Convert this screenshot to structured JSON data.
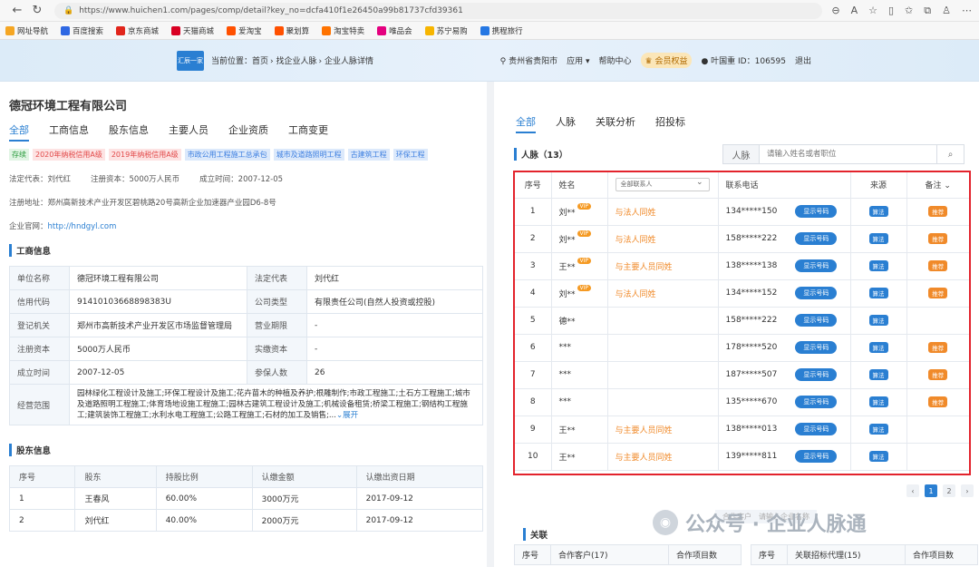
{
  "browser": {
    "url": "https://www.huichen1.com/pages/comp/detail?key_no=dcfa410f1e26450a99b81737cfd39361"
  },
  "bookmarks": [
    {
      "label": "网址导航",
      "color": "#f5a623"
    },
    {
      "label": "百度搜索",
      "color": "#2f68e3"
    },
    {
      "label": "京东商城",
      "color": "#e1251b"
    },
    {
      "label": "天猫商城",
      "color": "#d90023"
    },
    {
      "label": "爱淘宝",
      "color": "#ff5000"
    },
    {
      "label": "聚划算",
      "color": "#ff5000"
    },
    {
      "label": "淘宝特卖",
      "color": "#ff7300"
    },
    {
      "label": "唯品会",
      "color": "#e4007f"
    },
    {
      "label": "苏宁易购",
      "color": "#f7b500"
    },
    {
      "label": "携程旅行",
      "color": "#2577e3"
    }
  ],
  "header": {
    "logo": "汇辰一家",
    "breadcrumb": [
      "当前位置：首页",
      "找企业人脉",
      "企业人脉详情"
    ],
    "location": "贵州省贵阳市",
    "apps": "应用",
    "help": "帮助中心",
    "vip": "会员权益",
    "user": "叶国重 ID：106595",
    "logout": "退出"
  },
  "company": {
    "name": "德冠环境工程有限公司",
    "tabs": [
      "全部",
      "工商信息",
      "股东信息",
      "主要人员",
      "企业资质",
      "工商变更"
    ],
    "tags": [
      {
        "text": "存续",
        "cls": "t-green"
      },
      {
        "text": "2020年纳税信用A级",
        "cls": "t-red"
      },
      {
        "text": "2019年纳税信用A级",
        "cls": "t-red"
      },
      {
        "text": "市政公用工程施工总承包",
        "cls": "t-blue"
      },
      {
        "text": "城市及道路照明工程",
        "cls": "t-blue"
      },
      {
        "text": "古建筑工程",
        "cls": "t-blue"
      },
      {
        "text": "环保工程",
        "cls": "t-blue"
      }
    ],
    "legal_rep": "法定代表：刘代红",
    "capital": "注册资本：5000万人民币",
    "established": "成立时间：2007-12-05",
    "address": "注册地址：郑州高新技术产业开发区碧桃路20号高新企业加速器产业园D6-8号",
    "website_label": "企业官网：",
    "website": "http://hndgyl.com"
  },
  "biz_info": {
    "title": "工商信息",
    "rows": [
      [
        "单位名称",
        "德冠环境工程有限公司",
        "法定代表",
        "刘代红"
      ],
      [
        "信用代码",
        "91410103668898383U",
        "公司类型",
        "有限责任公司(自然人投资或控股)"
      ],
      [
        "登记机关",
        "郑州市高新技术产业开发区市场监督管理局",
        "营业期限",
        "-"
      ],
      [
        "注册资本",
        "5000万人民币",
        "实缴资本",
        "-"
      ],
      [
        "成立时间",
        "2007-12-05",
        "参保人数",
        "26"
      ]
    ],
    "scope_label": "经营范围",
    "scope": "园林绿化工程设计及施工;环保工程设计及施工;花卉苗木的种植及养护;根雕制作;市政工程施工;土石方工程施工;城市及道路照明工程施工;体育场地设施工程施工;园林古建筑工程设计及施工;机械设备租赁;桥梁工程施工;钢结构工程施工;建筑装饰工程施工;水利水电工程施工;公路工程施工;石材的加工及销售;...",
    "more": "展开"
  },
  "shareholders": {
    "title": "股东信息",
    "headers": [
      "序号",
      "股东",
      "持股比例",
      "认缴金额",
      "认缴出资日期"
    ],
    "rows": [
      [
        "1",
        "王春风",
        "60.00%",
        "3000万元",
        "2017-09-12"
      ],
      [
        "2",
        "刘代红",
        "40.00%",
        "2000万元",
        "2017-09-12"
      ]
    ]
  },
  "right": {
    "tabs": [
      "全部",
      "人脉",
      "关联分析",
      "招投标"
    ],
    "contacts_title": "人脉（13）",
    "search_label": "人脉",
    "search_placeholder": "请输入姓名或者职位",
    "headers": [
      "序号",
      "姓名",
      "全部联系人",
      "联系电话",
      "来源",
      "备注"
    ],
    "show_btn": "显示号码",
    "src_label": "算法",
    "rec_label": "推荐",
    "vip_label": "VIP",
    "rows": [
      {
        "no": "1",
        "name": "刘**",
        "vip": true,
        "rel": "与法人同姓",
        "phone": "134*****150",
        "rec": true
      },
      {
        "no": "2",
        "name": "刘**",
        "vip": true,
        "rel": "与法人同姓",
        "phone": "158*****222",
        "rec": true
      },
      {
        "no": "3",
        "name": "王**",
        "vip": true,
        "rel": "与主要人员同姓",
        "phone": "138*****138",
        "rec": true
      },
      {
        "no": "4",
        "name": "刘**",
        "vip": true,
        "rel": "与法人同姓",
        "phone": "134*****152",
        "rec": true
      },
      {
        "no": "5",
        "name": "德**",
        "vip": false,
        "rel": "",
        "phone": "158*****222",
        "rec": false
      },
      {
        "no": "6",
        "name": "***",
        "vip": false,
        "rel": "",
        "phone": "178*****520",
        "rec": true
      },
      {
        "no": "7",
        "name": "***",
        "vip": false,
        "rel": "",
        "phone": "187*****507",
        "rec": true
      },
      {
        "no": "8",
        "name": "***",
        "vip": false,
        "rel": "",
        "phone": "135*****670",
        "rec": true
      },
      {
        "no": "9",
        "name": "王**",
        "vip": false,
        "rel": "与主要人员同姓",
        "phone": "138*****013",
        "rec": false
      },
      {
        "no": "10",
        "name": "王**",
        "vip": false,
        "rel": "与主要人员同姓",
        "phone": "139*****811",
        "rec": false
      }
    ],
    "pages": [
      "1",
      "2"
    ],
    "assoc_title": "关联",
    "partner_search": "合作客户",
    "partner_placeholder": "请输入企业名称",
    "bottom_left": [
      "序号",
      "合作客户(17)",
      "合作项目数"
    ],
    "bottom_right": [
      "序号",
      "关联招标代理(15)",
      "合作项目数"
    ]
  },
  "watermark": "公众号 · 企业人脉通"
}
